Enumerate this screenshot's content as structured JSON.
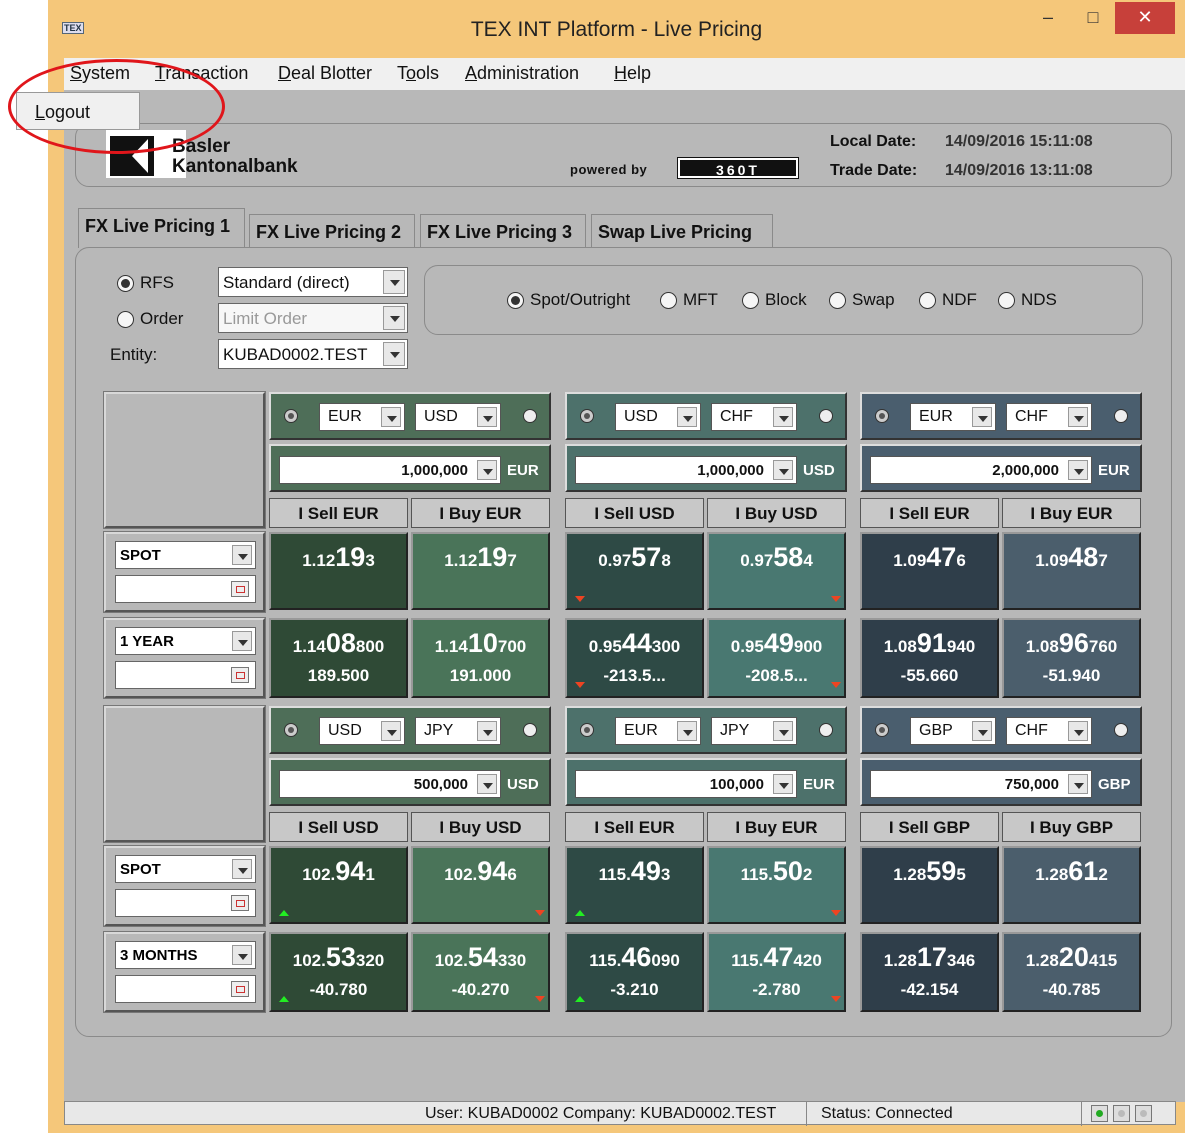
{
  "window": {
    "title": "TEX INT Platform - Live Pricing",
    "app_icon": "TEX",
    "minimize": "–",
    "maximize": "□",
    "close": "✕"
  },
  "menu": [
    {
      "label": "System",
      "u": "S",
      "rest": "ystem"
    },
    {
      "label": "Transaction",
      "u": "T",
      "rest": "ransaction"
    },
    {
      "label": "Deal Blotter",
      "u": "D",
      "rest": "eal Blotter"
    },
    {
      "label": "Tools",
      "pre": "T",
      "u": "o",
      "rest": "ols"
    },
    {
      "label": "Administration",
      "u": "A",
      "rest": "dministration"
    },
    {
      "label": "Help",
      "u": "H",
      "rest": "elp"
    }
  ],
  "system_menu": {
    "logout": "Logout",
    "logout_u": "L",
    "logout_rest": "ogout"
  },
  "header": {
    "bank_line1": "Basler",
    "bank_line2": "Kantonalbank",
    "powered_by": "powered by",
    "brand_360": "360T",
    "local_date_label": "Local Date:",
    "local_date": "14/09/2016 15:11:08",
    "trade_date_label": "Trade Date:",
    "trade_date": "14/09/2016 13:11:08"
  },
  "tabs": [
    "FX Live Pricing 1",
    "FX Live Pricing 2",
    "FX Live Pricing 3",
    "Swap Live Pricing"
  ],
  "active_tab": 0,
  "mode": {
    "rfs": "RFS",
    "order": "Order",
    "entity_label": "Entity:",
    "rfs_combo": "Standard (direct)",
    "order_combo": "Limit Order",
    "entity": "KUBAD0002.TEST"
  },
  "products": [
    "Spot/Outright",
    "MFT",
    "Block",
    "Swap",
    "NDF",
    "NDS"
  ],
  "selected_product": "Spot/Outright",
  "tenors": {
    "row1_top": "SPOT",
    "row1_bottom": "1 YEAR",
    "row2_top": "SPOT",
    "row2_bottom": "3 MONTHS"
  },
  "tiles": [
    {
      "base": "EUR",
      "quote": "USD",
      "amount": "1,000,000",
      "unit": "EUR",
      "sell": "I Sell EUR",
      "buy": "I Buy EUR",
      "spot_bid": {
        "a": "1.12",
        "b": "19",
        "c": "3"
      },
      "spot_ask": {
        "a": "1.12",
        "b": "19",
        "c": "7"
      },
      "fwd_bid": {
        "a": "1.14",
        "b": "08",
        "c": "800",
        "pips": "189.500"
      },
      "fwd_ask": {
        "a": "1.14",
        "b": "10",
        "c": "700",
        "pips": "191.000"
      }
    },
    {
      "base": "USD",
      "quote": "CHF",
      "amount": "1,000,000",
      "unit": "USD",
      "sell": "I Sell USD",
      "buy": "I Buy USD",
      "spot_bid": {
        "a": "0.97",
        "b": "57",
        "c": "8"
      },
      "spot_ask": {
        "a": "0.97",
        "b": "58",
        "c": "4"
      },
      "fwd_bid": {
        "a": "0.95",
        "b": "44",
        "c": "300",
        "pips": "-213.5..."
      },
      "fwd_ask": {
        "a": "0.95",
        "b": "49",
        "c": "900",
        "pips": "-208.5..."
      }
    },
    {
      "base": "EUR",
      "quote": "CHF",
      "amount": "2,000,000",
      "unit": "EUR",
      "sell": "I Sell EUR",
      "buy": "I Buy EUR",
      "spot_bid": {
        "a": "1.09",
        "b": "47",
        "c": "6"
      },
      "spot_ask": {
        "a": "1.09",
        "b": "48",
        "c": "7"
      },
      "fwd_bid": {
        "a": "1.08",
        "b": "91",
        "c": "940",
        "pips": "-55.660"
      },
      "fwd_ask": {
        "a": "1.08",
        "b": "96",
        "c": "760",
        "pips": "-51.940"
      }
    },
    {
      "base": "USD",
      "quote": "JPY",
      "amount": "500,000",
      "unit": "USD",
      "sell": "I Sell USD",
      "buy": "I Buy USD",
      "spot_bid": {
        "a": "102.",
        "b": "94",
        "c": "1"
      },
      "spot_ask": {
        "a": "102.",
        "b": "94",
        "c": "6"
      },
      "fwd_bid": {
        "a": "102.",
        "b": "53",
        "c": "320",
        "pips": "-40.780"
      },
      "fwd_ask": {
        "a": "102.",
        "b": "54",
        "c": "330",
        "pips": "-40.270"
      }
    },
    {
      "base": "EUR",
      "quote": "JPY",
      "amount": "100,000",
      "unit": "EUR",
      "sell": "I Sell EUR",
      "buy": "I Buy EUR",
      "spot_bid": {
        "a": "115.",
        "b": "49",
        "c": "3"
      },
      "spot_ask": {
        "a": "115.",
        "b": "50",
        "c": "2"
      },
      "fwd_bid": {
        "a": "115.",
        "b": "46",
        "c": "090",
        "pips": "-3.210"
      },
      "fwd_ask": {
        "a": "115.",
        "b": "47",
        "c": "420",
        "pips": "-2.780"
      }
    },
    {
      "base": "GBP",
      "quote": "CHF",
      "amount": "750,000",
      "unit": "GBP",
      "sell": "I Sell GBP",
      "buy": "I Buy GBP",
      "spot_bid": {
        "a": "1.28",
        "b": "59",
        "c": "5"
      },
      "spot_ask": {
        "a": "1.28",
        "b": "61",
        "c": "2"
      },
      "fwd_bid": {
        "a": "1.28",
        "b": "17",
        "c": "346",
        "pips": "-42.154"
      },
      "fwd_ask": {
        "a": "1.28",
        "b": "20",
        "c": "415",
        "pips": "-40.785"
      }
    }
  ],
  "status": {
    "user": "User: KUBAD0002 Company: KUBAD0002.TEST",
    "status": "Status:  Connected"
  },
  "colors": {
    "title_bg": "#f5c77a",
    "close": "#c7403a",
    "panel": "#b8b8b8",
    "tile_eurusd_bid": "#2f4a36",
    "tile_eurusd_ask": "#4a7459",
    "tile_usdchf_bid": "#2e4a45",
    "tile_usdchf_ask": "#497871",
    "tile_eurchf_bid": "#2f3e4a",
    "tile_eurchf_ask": "#4b5e6c"
  }
}
